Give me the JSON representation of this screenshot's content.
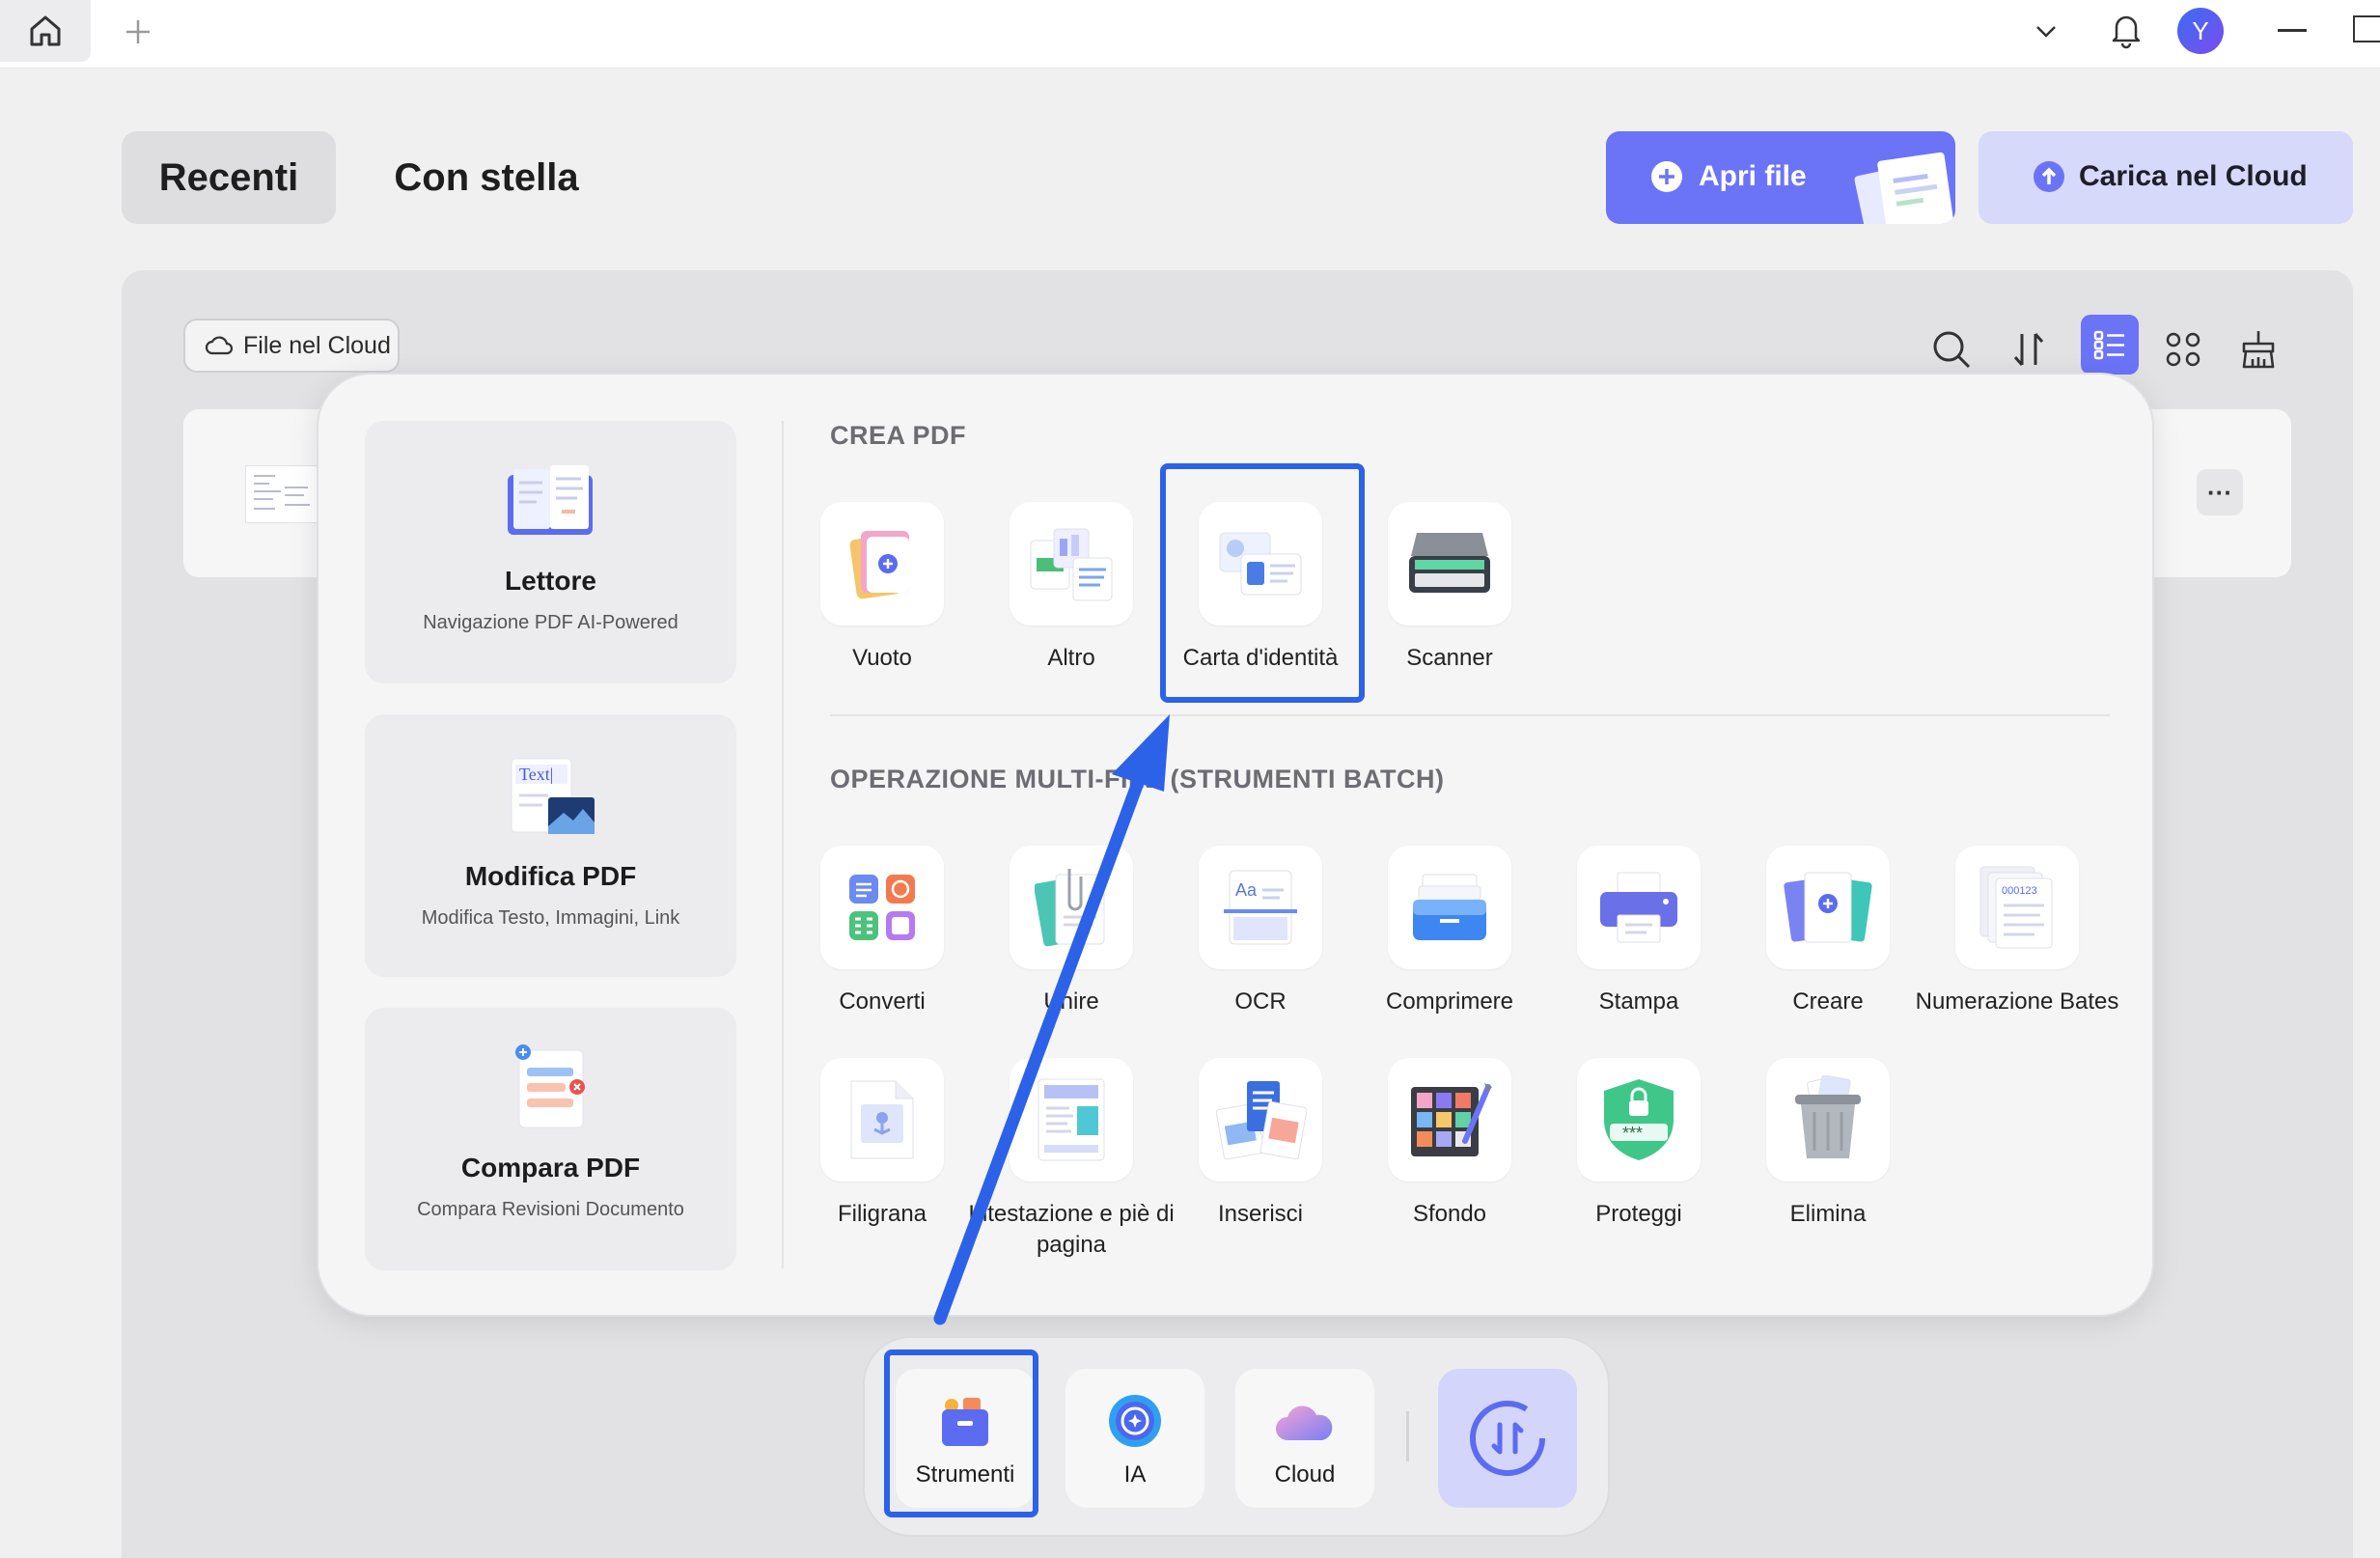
{
  "top_bar": {
    "avatar_initial": "Y"
  },
  "tabs": {
    "recent": "Recenti",
    "starred": "Con stella"
  },
  "actions": {
    "open_file": "Apri file",
    "upload_cloud": "Carica nel Cloud"
  },
  "filter": {
    "cloud_files": "File nel Cloud"
  },
  "file_row": {
    "more": "···"
  },
  "features": [
    {
      "title": "Lettore",
      "subtitle": "Navigazione PDF AI-Powered",
      "icon": "reader-book-icon"
    },
    {
      "title": "Modifica PDF",
      "subtitle": "Modifica Testo, Immagini, Link",
      "icon": "edit-text-image-icon",
      "icon_text": "Text|"
    },
    {
      "title": "Compara PDF",
      "subtitle": "Compara Revisioni Documento",
      "icon": "compare-docs-icon"
    }
  ],
  "create_pdf": {
    "heading": "CREA PDF",
    "items": [
      {
        "label": "Vuoto",
        "icon": "blank-page-icon"
      },
      {
        "label": "Altro",
        "icon": "other-formats-icon"
      },
      {
        "label": "Carta d'identità",
        "icon": "id-card-icon",
        "highlighted": true
      },
      {
        "label": "Scanner",
        "icon": "scanner-icon"
      }
    ]
  },
  "batch": {
    "heading": "OPERAZIONE MULTI-FILE (STRUMENTI BATCH)",
    "items": [
      {
        "label": "Converti",
        "icon": "convert-grid-icon"
      },
      {
        "label": "Unire",
        "icon": "merge-clip-icon"
      },
      {
        "label": "OCR",
        "icon": "ocr-scan-icon"
      },
      {
        "label": "Comprimere",
        "icon": "compress-tray-icon"
      },
      {
        "label": "Stampa",
        "icon": "printer-icon"
      },
      {
        "label": "Creare",
        "icon": "create-pages-icon"
      },
      {
        "label": "Numerazione Bates",
        "icon": "bates-number-icon",
        "icon_text": "000123"
      },
      {
        "label": "Filigrana",
        "icon": "watermark-icon"
      },
      {
        "label": "Intestazione e piè di pagina",
        "icon": "header-footer-icon"
      },
      {
        "label": "Inserisci",
        "icon": "insert-pages-icon"
      },
      {
        "label": "Sfondo",
        "icon": "background-palette-icon"
      },
      {
        "label": "Proteggi",
        "icon": "protect-shield-icon",
        "icon_text": "***"
      },
      {
        "label": "Elimina",
        "icon": "trash-bin-icon"
      }
    ]
  },
  "dock": {
    "tools": "Strumenti",
    "ai": "IA",
    "cloud": "Cloud"
  },
  "colors": {
    "accent": "#6b74f7",
    "accent_light": "#d7d9fb",
    "highlight": "#2c62e8",
    "annotation_arrow": "#2c62e8"
  }
}
